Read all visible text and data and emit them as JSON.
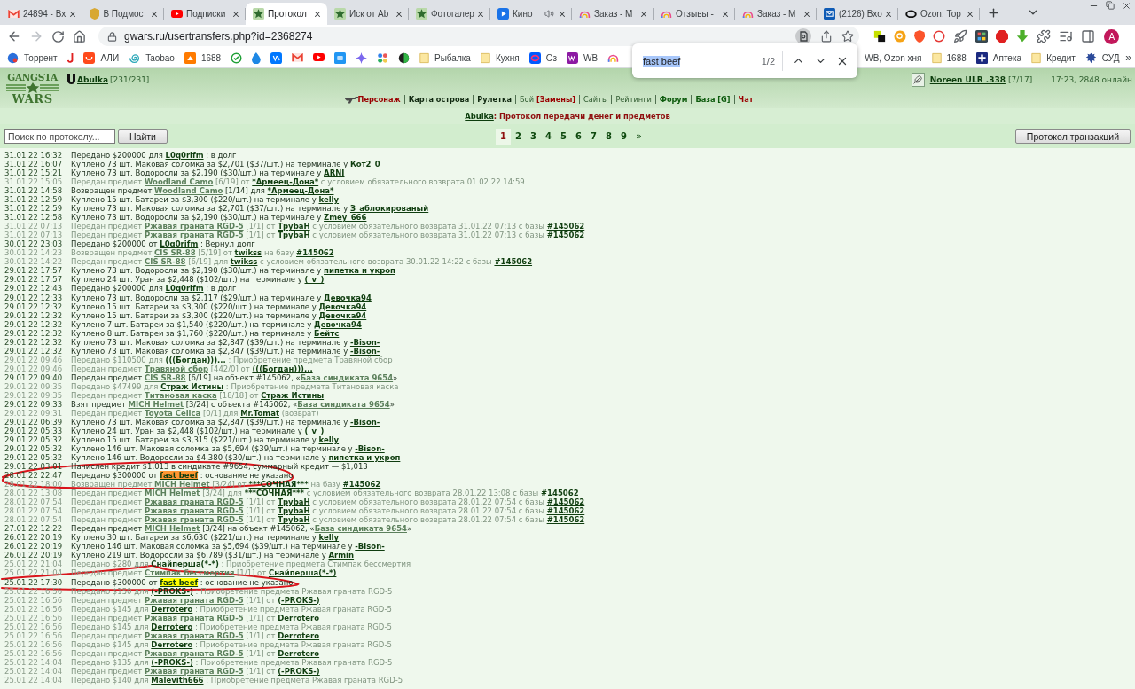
{
  "browser": {
    "tabs": [
      {
        "title": "24894 - Вх",
        "selected": false,
        "audio": false
      },
      {
        "title": "В Подмос",
        "selected": false,
        "audio": false
      },
      {
        "title": "Подписки",
        "selected": false,
        "audio": false
      },
      {
        "title": "Протокол",
        "selected": true,
        "audio": false
      },
      {
        "title": "Иск от Ab",
        "selected": false,
        "audio": false
      },
      {
        "title": "Фотогалер",
        "selected": false,
        "audio": false
      },
      {
        "title": "Кино",
        "selected": false,
        "audio": true
      },
      {
        "title": "Заказ - М",
        "selected": false,
        "audio": false
      },
      {
        "title": "Отзывы -",
        "selected": false,
        "audio": false
      },
      {
        "title": "Заказ - М",
        "selected": false,
        "audio": false
      },
      {
        "title": "(2126) Вхо",
        "selected": false,
        "audio": false
      },
      {
        "title": "Ozon: Тор",
        "selected": false,
        "audio": false
      }
    ],
    "forward_disabled": true,
    "url": "gwars.ru/usertransfers.php?id=2368274",
    "profile_initial": "A",
    "bookmarks": [
      {
        "kind": "link",
        "label": "Торрент"
      },
      {
        "kind": "icon"
      },
      {
        "kind": "link",
        "label": "АЛИ"
      },
      {
        "kind": "link",
        "label": "Taobao"
      },
      {
        "kind": "link",
        "label": "1688"
      },
      {
        "kind": "icon"
      },
      {
        "kind": "icon"
      },
      {
        "kind": "icon"
      },
      {
        "kind": "icon"
      },
      {
        "kind": "icon"
      },
      {
        "kind": "icon"
      },
      {
        "kind": "icon"
      },
      {
        "kind": "icon"
      },
      {
        "kind": "icon"
      },
      {
        "kind": "folder",
        "label": "Рыбалка"
      },
      {
        "kind": "folder",
        "label": "Кухня"
      },
      {
        "kind": "link",
        "label": "Оз"
      },
      {
        "kind": "link",
        "label": "WB"
      },
      {
        "kind": "icon"
      },
      {
        "kind": "label",
        "label": "WB, Ozon хня"
      },
      {
        "kind": "folder",
        "label": "1688"
      },
      {
        "kind": "link",
        "label": "Аптека"
      },
      {
        "kind": "folder",
        "label": "Кредит"
      },
      {
        "kind": "link",
        "label": "СУД"
      }
    ],
    "bookmarks_more": "»"
  },
  "find_bar": {
    "query": "fast beef",
    "count": "1/2"
  },
  "page": {
    "logo": [
      "GANGSTA",
      "WARS"
    ],
    "user": {
      "name": "Abulka",
      "stats": "[231/231]"
    },
    "other_user": {
      "name": "Noreen ULR .338",
      "stats": "[7/17]"
    },
    "status": "17:23, 2848 онлайн",
    "nav": [
      {
        "links": [
          {
            "text": "Персонаж",
            "kind": "alert"
          }
        ]
      },
      {
        "links": [
          {
            "text": "Карта острова",
            "kind": "strong"
          }
        ]
      },
      {
        "links": [
          {
            "text": "Рулетка",
            "kind": "strong"
          }
        ]
      },
      {
        "links": [
          {
            "text": "Бой",
            "kind": "plain"
          },
          {
            "text": "[Замены]",
            "kind": "alert"
          }
        ]
      },
      {
        "links": [
          {
            "text": "Сайты",
            "kind": "plain"
          }
        ]
      },
      {
        "links": [
          {
            "text": "Рейтинги",
            "kind": "plain"
          }
        ]
      },
      {
        "links": [
          {
            "text": "Форум",
            "kind": "section"
          }
        ]
      },
      {
        "links": [
          {
            "text": "База [G]",
            "kind": "section"
          }
        ]
      },
      {
        "links": [
          {
            "text": "Чат",
            "kind": "alert"
          }
        ]
      }
    ],
    "title": {
      "user": "Abulka",
      "text": ": Протокол передачи денег и предметов"
    },
    "search": {
      "placeholder": "Поиск по протоколу...",
      "button": "Найти"
    },
    "pages": [
      {
        "label": "1",
        "selected": true
      },
      {
        "label": "2",
        "selected": false
      },
      {
        "label": "3",
        "selected": false
      },
      {
        "label": "4",
        "selected": false
      },
      {
        "label": "5",
        "selected": false
      },
      {
        "label": "6",
        "selected": false
      },
      {
        "label": "7",
        "selected": false
      },
      {
        "label": "8",
        "selected": false
      },
      {
        "label": "9",
        "selected": false
      },
      {
        "label": "»",
        "selected": false
      }
    ],
    "transactions_button": "Протокол транзакций",
    "log": [
      {
        "date": "31.01.22 16:32",
        "dimmed": false,
        "circled": false,
        "parts": [
          {
            "kind": "text",
            "text": "Передано $200000 для "
          },
          {
            "kind": "player",
            "text": "L0q0rifm"
          },
          {
            "kind": "text",
            "text": " : в долг"
          }
        ]
      },
      {
        "date": "31.01.22 16:07",
        "dimmed": false,
        "circled": false,
        "parts": [
          {
            "kind": "text",
            "text": "Куплено 73 шт. Маковая соломка за $2,701 ($37/шт.) на терминале у "
          },
          {
            "kind": "player",
            "text": "Кот2_0"
          }
        ]
      },
      {
        "date": "31.01.22 15:21",
        "dimmed": false,
        "circled": false,
        "parts": [
          {
            "kind": "text",
            "text": "Куплено 73 шт. Водоросли за $2,190 ($30/шт.) на терминале у "
          },
          {
            "kind": "player",
            "text": "ARNI"
          }
        ]
      },
      {
        "date": "31.01.22 15:05",
        "dimmed": true,
        "circled": false,
        "parts": [
          {
            "kind": "text",
            "text": "Передан предмет "
          },
          {
            "kind": "item",
            "text": "Woodland Camo"
          },
          {
            "kind": "text",
            "text": " [6/19] от "
          },
          {
            "kind": "player",
            "text": "*Армеец-Дона*"
          },
          {
            "kind": "text",
            "text": " с условием обязательного возврата 01.02.22 14:59"
          }
        ]
      },
      {
        "date": "31.01.22 14:58",
        "dimmed": false,
        "circled": false,
        "parts": [
          {
            "kind": "text",
            "text": "Возвращен предмет "
          },
          {
            "kind": "item",
            "text": "Woodland Camo"
          },
          {
            "kind": "text",
            "text": " [1/14] для "
          },
          {
            "kind": "player",
            "text": "*Армеец-Дона*"
          }
        ]
      },
      {
        "date": "31.01.22 12:59",
        "dimmed": false,
        "circled": false,
        "parts": [
          {
            "kind": "text",
            "text": "Куплено 15 шт. Батареи за $3,300 ($220/шт.) на терминале у "
          },
          {
            "kind": "player",
            "text": "kelly"
          }
        ]
      },
      {
        "date": "31.01.22 12:59",
        "dimmed": false,
        "circled": false,
        "parts": [
          {
            "kind": "text",
            "text": "Куплено 73 шт. Маковая соломка за $2,701 ($37/шт.) на терминале у "
          },
          {
            "kind": "player",
            "text": "З_аблокированый"
          }
        ]
      },
      {
        "date": "31.01.22 12:58",
        "dimmed": false,
        "circled": false,
        "parts": [
          {
            "kind": "text",
            "text": "Куплено 73 шт. Водоросли за $2,190 ($30/шт.) на терминале у "
          },
          {
            "kind": "player",
            "text": "Zmey_666"
          }
        ]
      },
      {
        "date": "31.01.22 07:13",
        "dimmed": true,
        "circled": false,
        "parts": [
          {
            "kind": "text",
            "text": "Передан предмет "
          },
          {
            "kind": "item",
            "text": "Ржавая граната RGD-5"
          },
          {
            "kind": "text",
            "text": " [1/1] от "
          },
          {
            "kind": "player",
            "text": "TpybaH"
          },
          {
            "kind": "text",
            "text": " с условием обязательного возврата 31.01.22 07:13 с базы "
          },
          {
            "kind": "base",
            "text": "#145062"
          }
        ]
      },
      {
        "date": "31.01.22 07:13",
        "dimmed": true,
        "circled": false,
        "parts": [
          {
            "kind": "text",
            "text": "Передан предмет "
          },
          {
            "kind": "item",
            "text": "Ржавая граната RGD-5"
          },
          {
            "kind": "text",
            "text": " [1/1] от "
          },
          {
            "kind": "player",
            "text": "TpybaH"
          },
          {
            "kind": "text",
            "text": " с условием обязательного возврата 31.01.22 07:13 с базы "
          },
          {
            "kind": "base",
            "text": "#145062"
          }
        ]
      },
      {
        "date": "30.01.22 23:03",
        "dimmed": false,
        "circled": false,
        "parts": [
          {
            "kind": "text",
            "text": "Передано $200000 от "
          },
          {
            "kind": "player",
            "text": "L0q0rifm"
          },
          {
            "kind": "text",
            "text": " : Вернул долг"
          }
        ]
      },
      {
        "date": "30.01.22 14:23",
        "dimmed": true,
        "circled": false,
        "parts": [
          {
            "kind": "text",
            "text": "Возвращен предмет "
          },
          {
            "kind": "item",
            "text": "CIS SR-88"
          },
          {
            "kind": "text",
            "text": " [5/19] от "
          },
          {
            "kind": "player",
            "text": "twikss"
          },
          {
            "kind": "text",
            "text": " на базу "
          },
          {
            "kind": "base",
            "text": "#145062"
          }
        ]
      },
      {
        "date": "30.01.22 14:22",
        "dimmed": true,
        "circled": false,
        "parts": [
          {
            "kind": "text",
            "text": "Передан предмет "
          },
          {
            "kind": "item",
            "text": "CIS SR-88"
          },
          {
            "kind": "text",
            "text": " [6/19] для "
          },
          {
            "kind": "player",
            "text": "twikss"
          },
          {
            "kind": "text",
            "text": " с условием обязательного возврата 30.01.22 14:22 с базы "
          },
          {
            "kind": "base",
            "text": "#145062"
          }
        ]
      },
      {
        "date": "29.01.22 17:57",
        "dimmed": false,
        "circled": false,
        "parts": [
          {
            "kind": "text",
            "text": "Куплено 73 шт. Водоросли за $2,190 ($30/шт.) на терминале у "
          },
          {
            "kind": "player",
            "text": "пипетка и укроп"
          }
        ]
      },
      {
        "date": "29.01.22 17:57",
        "dimmed": false,
        "circled": false,
        "parts": [
          {
            "kind": "text",
            "text": "Куплено 24 шт. Уран за $2,448 ($102/шт.) на терминале у "
          },
          {
            "kind": "player",
            "text": "(_v_)"
          }
        ]
      },
      {
        "date": "29.01.22 12:43",
        "dimmed": false,
        "circled": false,
        "parts": [
          {
            "kind": "text",
            "text": "Передано $200000 для "
          },
          {
            "kind": "player",
            "text": "L0q0rifm"
          },
          {
            "kind": "text",
            "text": " : в долг"
          }
        ]
      },
      {
        "date": "29.01.22 12:33",
        "dimmed": false,
        "circled": false,
        "parts": [
          {
            "kind": "text",
            "text": "Куплено 73 шт. Водоросли за $2,117 ($29/шт.) на терминале у "
          },
          {
            "kind": "player",
            "text": "Девочка94"
          }
        ]
      },
      {
        "date": "29.01.22 12:32",
        "dimmed": false,
        "circled": false,
        "parts": [
          {
            "kind": "text",
            "text": "Куплено 15 шт. Батареи за $3,300 ($220/шт.) на терминале у "
          },
          {
            "kind": "player",
            "text": "Девочка94"
          }
        ]
      },
      {
        "date": "29.01.22 12:32",
        "dimmed": false,
        "circled": false,
        "parts": [
          {
            "kind": "text",
            "text": "Куплено 15 шт. Батареи за $3,300 ($220/шт.) на терминале у "
          },
          {
            "kind": "player",
            "text": "Девочка94"
          }
        ]
      },
      {
        "date": "29.01.22 12:32",
        "dimmed": false,
        "circled": false,
        "parts": [
          {
            "kind": "text",
            "text": "Куплено 7 шт. Батареи за $1,540 ($220/шт.) на терминале у "
          },
          {
            "kind": "player",
            "text": "Девочка94"
          }
        ]
      },
      {
        "date": "29.01.22 12:32",
        "dimmed": false,
        "circled": false,
        "parts": [
          {
            "kind": "text",
            "text": "Куплено 8 шт. Батареи за $1,760 ($220/шт.) на терминале у "
          },
          {
            "kind": "player",
            "text": "Бейтс"
          }
        ]
      },
      {
        "date": "29.01.22 12:32",
        "dimmed": false,
        "circled": false,
        "parts": [
          {
            "kind": "text",
            "text": "Куплено 73 шт. Маковая соломка за $2,847 ($39/шт.) на терминале у "
          },
          {
            "kind": "player",
            "text": "-Bison-"
          }
        ]
      },
      {
        "date": "29.01.22 12:32",
        "dimmed": false,
        "circled": false,
        "parts": [
          {
            "kind": "text",
            "text": "Куплено 73 шт. Маковая соломка за $2,847 ($39/шт.) на терминале у "
          },
          {
            "kind": "player",
            "text": "-Bison-"
          }
        ]
      },
      {
        "date": "29.01.22 09:46",
        "dimmed": true,
        "circled": false,
        "parts": [
          {
            "kind": "text",
            "text": "Передано $110500 для "
          },
          {
            "kind": "player",
            "text": "(((Богдан)))..."
          },
          {
            "kind": "text",
            "text": " : Приобретение предмета Травяной сбор"
          }
        ]
      },
      {
        "date": "29.01.22 09:46",
        "dimmed": true,
        "circled": false,
        "parts": [
          {
            "kind": "text",
            "text": "Передан предмет "
          },
          {
            "kind": "item",
            "text": "Травяной сбор"
          },
          {
            "kind": "text",
            "text": " [442/0] от "
          },
          {
            "kind": "player",
            "text": "(((Богдан)))..."
          }
        ]
      },
      {
        "date": "29.01.22 09:40",
        "dimmed": false,
        "circled": false,
        "parts": [
          {
            "kind": "text",
            "text": "Передан предмет "
          },
          {
            "kind": "item",
            "text": "CIS SR-88"
          },
          {
            "kind": "text",
            "text": " [6/19] на объект #145062, «"
          },
          {
            "kind": "item",
            "text": "База синдиката 9654"
          },
          {
            "kind": "text",
            "text": "»"
          }
        ]
      },
      {
        "date": "29.01.22 09:35",
        "dimmed": true,
        "circled": false,
        "parts": [
          {
            "kind": "text",
            "text": "Передано $47499 для "
          },
          {
            "kind": "player",
            "text": "Страж Истины"
          },
          {
            "kind": "text",
            "text": " : Приобретение предмета Титановая каска"
          }
        ]
      },
      {
        "date": "29.01.22 09:35",
        "dimmed": true,
        "circled": false,
        "parts": [
          {
            "kind": "text",
            "text": "Передан предмет "
          },
          {
            "kind": "item",
            "text": "Титановая каска"
          },
          {
            "kind": "text",
            "text": " [18/18] от "
          },
          {
            "kind": "player",
            "text": "Страж Истины"
          }
        ]
      },
      {
        "date": "29.01.22 09:33",
        "dimmed": false,
        "circled": false,
        "parts": [
          {
            "kind": "text",
            "text": "Взят предмет "
          },
          {
            "kind": "item",
            "text": "MICH Helmet"
          },
          {
            "kind": "text",
            "text": " [3/24] с объекта #145062, «"
          },
          {
            "kind": "item",
            "text": "База синдиката 9654"
          },
          {
            "kind": "text",
            "text": "»"
          }
        ]
      },
      {
        "date": "29.01.22 09:31",
        "dimmed": true,
        "circled": false,
        "parts": [
          {
            "kind": "text",
            "text": "Передан предмет "
          },
          {
            "kind": "item",
            "text": "Toyota Celica"
          },
          {
            "kind": "text",
            "text": " [0/1] для "
          },
          {
            "kind": "player",
            "text": "Mr.Tomat"
          },
          {
            "kind": "text",
            "text": " (возврат)"
          }
        ]
      },
      {
        "date": "29.01.22 06:39",
        "dimmed": false,
        "circled": false,
        "parts": [
          {
            "kind": "text",
            "text": "Куплено 73 шт. Маковая соломка за $2,847 ($39/шт.) на терминале у "
          },
          {
            "kind": "player",
            "text": "-Bison-"
          }
        ]
      },
      {
        "date": "29.01.22 05:33",
        "dimmed": false,
        "circled": false,
        "parts": [
          {
            "kind": "text",
            "text": "Куплено 24 шт. Уран за $2,448 ($102/шт.) на терминале у "
          },
          {
            "kind": "player",
            "text": "(_v_)"
          }
        ]
      },
      {
        "date": "29.01.22 05:32",
        "dimmed": false,
        "circled": false,
        "parts": [
          {
            "kind": "text",
            "text": "Куплено 15 шт. Батареи за $3,315 ($221/шт.) на терминале у "
          },
          {
            "kind": "player",
            "text": "kelly"
          }
        ]
      },
      {
        "date": "29.01.22 05:32",
        "dimmed": false,
        "circled": false,
        "parts": [
          {
            "kind": "text",
            "text": "Куплено 146 шт. Маковая соломка за $5,694 ($39/шт.) на терминале у "
          },
          {
            "kind": "player",
            "text": "-Bison-"
          }
        ]
      },
      {
        "date": "29.01.22 05:32",
        "dimmed": false,
        "circled": false,
        "parts": [
          {
            "kind": "text",
            "text": "Куплено 146 шт. Водоросли за $4,380 ($30/шт.) на терминале у "
          },
          {
            "kind": "player",
            "text": "пипетка и укроп"
          }
        ]
      },
      {
        "date": "29.01.22 03:01",
        "dimmed": false,
        "circled": false,
        "parts": [
          {
            "kind": "text",
            "text": "Начислен кредит $1,013 в синдикате #9654, суммарный кредит — $1,013"
          }
        ]
      },
      {
        "date": "28.01.22 22:47",
        "dimmed": false,
        "circled": true,
        "parts": [
          {
            "kind": "text",
            "text": "Передано $300000 от "
          },
          {
            "kind": "match",
            "text": "fast beef",
            "current": true
          },
          {
            "kind": "text",
            "text": " : основание не указано"
          }
        ]
      },
      {
        "date": "28.01.22 18:00",
        "dimmed": true,
        "circled": false,
        "parts": [
          {
            "kind": "text",
            "text": "Возвращен предмет "
          },
          {
            "kind": "item",
            "text": "MICH Helmet"
          },
          {
            "kind": "text",
            "text": " [3/24] от "
          },
          {
            "kind": "player",
            "text": "***СОЧНАЯ***"
          },
          {
            "kind": "text",
            "text": " на базу "
          },
          {
            "kind": "base",
            "text": "#145062"
          }
        ]
      },
      {
        "date": "28.01.22 13:08",
        "dimmed": true,
        "circled": false,
        "parts": [
          {
            "kind": "text",
            "text": "Передан предмет "
          },
          {
            "kind": "item",
            "text": "MICH Helmet"
          },
          {
            "kind": "text",
            "text": " [3/24] для "
          },
          {
            "kind": "player",
            "text": "***СОЧНАЯ***"
          },
          {
            "kind": "text",
            "text": " с условием обязательного возврата 28.01.22 13:08 с базы "
          },
          {
            "kind": "base",
            "text": "#145062"
          }
        ]
      },
      {
        "date": "28.01.22 07:54",
        "dimmed": true,
        "circled": false,
        "parts": [
          {
            "kind": "text",
            "text": "Передан предмет "
          },
          {
            "kind": "item",
            "text": "Ржавая граната RGD-5"
          },
          {
            "kind": "text",
            "text": " [1/1] от "
          },
          {
            "kind": "player",
            "text": "TpybaH"
          },
          {
            "kind": "text",
            "text": " с условием обязательного возврата 28.01.22 07:54 с базы "
          },
          {
            "kind": "base",
            "text": "#145062"
          }
        ]
      },
      {
        "date": "28.01.22 07:54",
        "dimmed": true,
        "circled": false,
        "parts": [
          {
            "kind": "text",
            "text": "Передан предмет "
          },
          {
            "kind": "item",
            "text": "Ржавая граната RGD-5"
          },
          {
            "kind": "text",
            "text": " [1/1] от "
          },
          {
            "kind": "player",
            "text": "TpybaH"
          },
          {
            "kind": "text",
            "text": " с условием обязательного возврата 28.01.22 07:54 с базы "
          },
          {
            "kind": "base",
            "text": "#145062"
          }
        ]
      },
      {
        "date": "28.01.22 07:54",
        "dimmed": true,
        "circled": false,
        "parts": [
          {
            "kind": "text",
            "text": "Передан предмет "
          },
          {
            "kind": "item",
            "text": "Ржавая граната RGD-5"
          },
          {
            "kind": "text",
            "text": " [1/1] от "
          },
          {
            "kind": "player",
            "text": "TpybaH"
          },
          {
            "kind": "text",
            "text": " с условием обязательного возврата 28.01.22 07:54 с базы "
          },
          {
            "kind": "base",
            "text": "#145062"
          }
        ]
      },
      {
        "date": "27.01.22 12:22",
        "dimmed": false,
        "circled": false,
        "parts": [
          {
            "kind": "text",
            "text": "Передан предмет "
          },
          {
            "kind": "item",
            "text": "MICH Helmet"
          },
          {
            "kind": "text",
            "text": " [3/24] на объект #145062, «"
          },
          {
            "kind": "item",
            "text": "База синдиката 9654"
          },
          {
            "kind": "text",
            "text": "»"
          }
        ]
      },
      {
        "date": "26.01.22 20:19",
        "dimmed": false,
        "circled": false,
        "parts": [
          {
            "kind": "text",
            "text": "Куплено 30 шт. Батареи за $6,630 ($221/шт.) на терминале у "
          },
          {
            "kind": "player",
            "text": "kelly"
          }
        ]
      },
      {
        "date": "26.01.22 20:19",
        "dimmed": false,
        "circled": false,
        "parts": [
          {
            "kind": "text",
            "text": "Куплено 146 шт. Маковая соломка за $5,694 ($39/шт.) на терминале у "
          },
          {
            "kind": "player",
            "text": "-Bison-"
          }
        ]
      },
      {
        "date": "26.01.22 20:19",
        "dimmed": false,
        "circled": false,
        "parts": [
          {
            "kind": "text",
            "text": "Куплено 219 шт. Водоросли за $6,789 ($31/шт.) на терминале у "
          },
          {
            "kind": "player",
            "text": "Armin"
          }
        ]
      },
      {
        "date": "25.01.22 21:04",
        "dimmed": true,
        "circled": false,
        "parts": [
          {
            "kind": "text",
            "text": "Передано $280 для "
          },
          {
            "kind": "player",
            "text": "Снайперша(*-*)"
          },
          {
            "kind": "text",
            "text": " : Приобретение предмета Стимпак бессмертия"
          }
        ]
      },
      {
        "date": "25.01.22 21:04",
        "dimmed": true,
        "circled": false,
        "parts": [
          {
            "kind": "text",
            "text": "Передан предмет "
          },
          {
            "kind": "item",
            "text": "Стимпак бессмертия"
          },
          {
            "kind": "text",
            "text": " [1/1] от "
          },
          {
            "kind": "player",
            "text": "Снайперша(*-*)"
          }
        ]
      },
      {
        "date": "25.01.22 17:30",
        "dimmed": false,
        "circled": true,
        "parts": [
          {
            "kind": "text",
            "text": "Передано $300000 от "
          },
          {
            "kind": "match",
            "text": "fast beef",
            "current": false
          },
          {
            "kind": "text",
            "text": " : основание не указано"
          }
        ]
      },
      {
        "date": "25.01.22 16:56",
        "dimmed": true,
        "circled": false,
        "parts": [
          {
            "kind": "text",
            "text": "Передано $150 для "
          },
          {
            "kind": "player",
            "text": "(-PROKS-)"
          },
          {
            "kind": "text",
            "text": " : Приобретение предмета Ржавая граната RGD-5"
          }
        ]
      },
      {
        "date": "25.01.22 16:56",
        "dimmed": true,
        "circled": false,
        "parts": [
          {
            "kind": "text",
            "text": "Передан предмет "
          },
          {
            "kind": "item",
            "text": "Ржавая граната RGD-5"
          },
          {
            "kind": "text",
            "text": " [1/1] от "
          },
          {
            "kind": "player",
            "text": "(-PROKS-)"
          }
        ]
      },
      {
        "date": "25.01.22 16:56",
        "dimmed": true,
        "circled": false,
        "parts": [
          {
            "kind": "text",
            "text": "Передано $145 для "
          },
          {
            "kind": "player",
            "text": "Derrotero"
          },
          {
            "kind": "text",
            "text": " : Приобретение предмета Ржавая граната RGD-5"
          }
        ]
      },
      {
        "date": "25.01.22 16:56",
        "dimmed": true,
        "circled": false,
        "parts": [
          {
            "kind": "text",
            "text": "Передан предмет "
          },
          {
            "kind": "item",
            "text": "Ржавая граната RGD-5"
          },
          {
            "kind": "text",
            "text": " [1/1] от "
          },
          {
            "kind": "player",
            "text": "Derrotero"
          }
        ]
      },
      {
        "date": "25.01.22 16:56",
        "dimmed": true,
        "circled": false,
        "parts": [
          {
            "kind": "text",
            "text": "Передано $145 для "
          },
          {
            "kind": "player",
            "text": "Derrotero"
          },
          {
            "kind": "text",
            "text": " : Приобретение предмета Ржавая граната RGD-5"
          }
        ]
      },
      {
        "date": "25.01.22 16:56",
        "dimmed": true,
        "circled": false,
        "parts": [
          {
            "kind": "text",
            "text": "Передан предмет "
          },
          {
            "kind": "item",
            "text": "Ржавая граната RGD-5"
          },
          {
            "kind": "text",
            "text": " [1/1] от "
          },
          {
            "kind": "player",
            "text": "Derrotero"
          }
        ]
      },
      {
        "date": "25.01.22 16:56",
        "dimmed": true,
        "circled": false,
        "parts": [
          {
            "kind": "text",
            "text": "Передано $145 для "
          },
          {
            "kind": "player",
            "text": "Derrotero"
          },
          {
            "kind": "text",
            "text": " : Приобретение предмета Ржавая граната RGD-5"
          }
        ]
      },
      {
        "date": "25.01.22 16:56",
        "dimmed": true,
        "circled": false,
        "parts": [
          {
            "kind": "text",
            "text": "Передан предмет "
          },
          {
            "kind": "item",
            "text": "Ржавая граната RGD-5"
          },
          {
            "kind": "text",
            "text": " [1/1] от "
          },
          {
            "kind": "player",
            "text": "Derrotero"
          }
        ]
      },
      {
        "date": "25.01.22 14:04",
        "dimmed": true,
        "circled": false,
        "parts": [
          {
            "kind": "text",
            "text": "Передано $135 для "
          },
          {
            "kind": "player",
            "text": "(-PROKS-)"
          },
          {
            "kind": "text",
            "text": " : Приобретение предмета Ржавая граната RGD-5"
          }
        ]
      },
      {
        "date": "25.01.22 14:04",
        "dimmed": true,
        "circled": false,
        "parts": [
          {
            "kind": "text",
            "text": "Передан предмет "
          },
          {
            "kind": "item",
            "text": "Ржавая граната RGD-5"
          },
          {
            "kind": "text",
            "text": " [1/1] от "
          },
          {
            "kind": "player",
            "text": "(-PROKS-)"
          }
        ]
      },
      {
        "date": "25.01.22 14:04",
        "dimmed": true,
        "circled": false,
        "parts": [
          {
            "kind": "text",
            "text": "Передано $140 для "
          },
          {
            "kind": "player",
            "text": "Malevith666"
          },
          {
            "kind": "text",
            "text": " : Приобретение предмета Ржавая граната RGD-5"
          }
        ]
      }
    ]
  }
}
